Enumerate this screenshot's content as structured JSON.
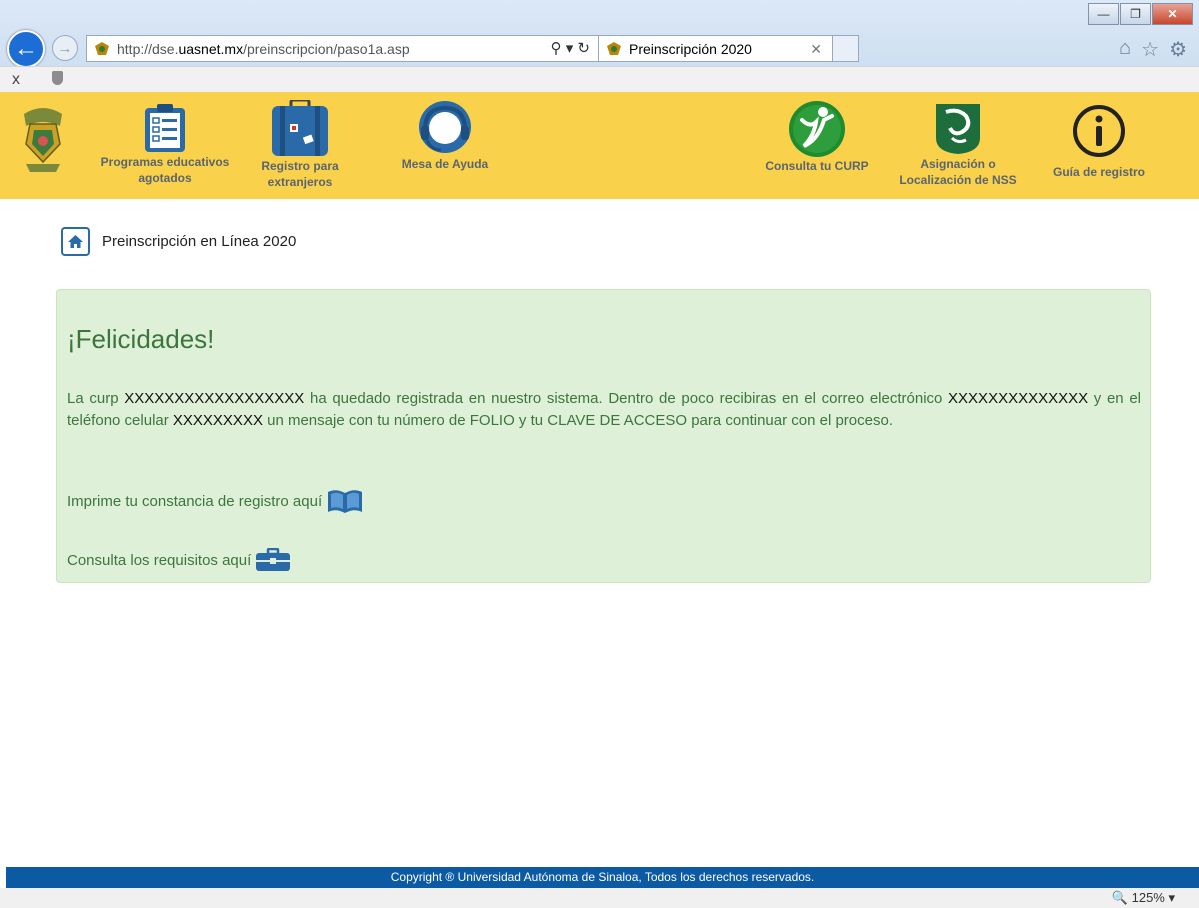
{
  "browser": {
    "url_prefix": "http://dse.",
    "url_domain": "uasnet.mx",
    "url_path": "/preinscripcion/paso1a.asp",
    "tab_title": "Preinscripción 2020",
    "zoom": "125%"
  },
  "nav": {
    "items": [
      {
        "label": "Programas educativos agotados"
      },
      {
        "label": "Registro para extranjeros"
      },
      {
        "label": "Mesa de Ayuda"
      },
      {
        "label": "Consulta tu CURP"
      },
      {
        "label": "Asignación o Localización de NSS"
      },
      {
        "label": "Guía de registro"
      }
    ]
  },
  "breadcrumb": {
    "label": "Preinscripción en Línea 2020"
  },
  "alert": {
    "title": "¡Felicidades!",
    "t1": "La curp ",
    "curp": "XXXXXXXXXXXXXXXXXX",
    "t2": " ha quedado registrada en nuestro sistema. Dentro de poco recibiras en el correo electrónico ",
    "email": "XXXXXXXXXXXXXX",
    "t3": "  y en el teléfono celular ",
    "phone": "XXXXXXXXX",
    "t4": " un mensaje con tu número de FOLIO y tu CLAVE DE ACCESO para continuar con el proceso.",
    "print_label": "Imprime tu constancia de registro aquí",
    "requirements_label": "Consulta los requisitos aquí"
  },
  "footer": {
    "copyright": "Copyright ® Universidad Autónoma de Sinaloa, Todos los derechos reservados."
  },
  "colors": {
    "nav_bg": "#f9d14a",
    "alert_bg": "#dff0d8",
    "alert_text": "#3c763d",
    "footer_bg": "#0b5aa3",
    "brand_blue": "#2a6aa8"
  }
}
